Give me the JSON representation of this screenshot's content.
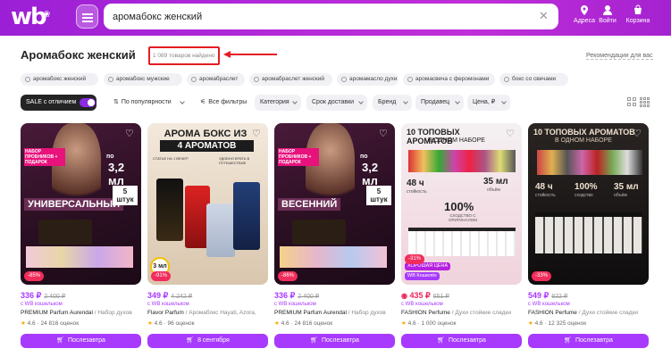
{
  "header": {
    "logo": "wb",
    "search_value": "аромабокс женский",
    "buttons": [
      {
        "label": "Адреса",
        "icon": "location-pin-icon"
      },
      {
        "label": "Войти",
        "icon": "user-icon"
      },
      {
        "label": "Корзина",
        "icon": "cart-icon"
      }
    ]
  },
  "page": {
    "title": "Аромабокс женский",
    "count": "1 089 товаров найдено",
    "recommendations": "Рекомендации для вас"
  },
  "chips": [
    "аромабокс женский",
    "аромабокс мужские",
    "аромабраслет",
    "аромабраслет женский",
    "аромамасло духи",
    "аромасвеча с феромонами",
    "бокс со свечами"
  ],
  "filters": {
    "sale_label": "SALE с отличием",
    "sort": "По популярности",
    "items": [
      "Все фильтры",
      "Категория",
      "Срок доставки",
      "Бренд",
      "Продавец",
      "Цена, ₽"
    ]
  },
  "products": [
    {
      "price": "336 ₽",
      "old_price": "2 400 ₽",
      "wallet": "с WB кошельком",
      "brand": "PREMIUM Parfum Aurendal",
      "desc": "Набор духов",
      "rating": "4.6",
      "reviews": "24 816 оценок",
      "button": "Послезавтра",
      "discount": "-85%",
      "overlay": [
        "НАБОР ПРОБНИКОВ + ПОДАРОК",
        "УНИВЕРСАЛЬНЫЙ",
        "3,2 мл",
        "5 штук",
        "по"
      ]
    },
    {
      "price": "349 ₽",
      "old_price": "4 242 ₽",
      "wallet": "с WB кошельком",
      "brand": "Flavor Parfum",
      "desc": "Аромабокс Hayati, Azora,",
      "rating": "4.6",
      "reviews": "96 оценок",
      "button": "8 сентября",
      "discount": "-91%",
      "overlay": [
        "АРОМА БОКС ИЗ",
        "4 АРОМАТОВ",
        "3 мл",
        "СТАТЬЕ НА 1 ВЕЧЕР",
        "УДОБНО БРАТЬ В ПУТЕШЕСТВИЕ"
      ]
    },
    {
      "price": "336 ₽",
      "old_price": "2 400 ₽",
      "wallet": "с WB кошельком",
      "brand": "PREMIUM Parfum Aurendal",
      "desc": "Набор духов",
      "rating": "4.6",
      "reviews": "24 816 оценок",
      "button": "Послезавтра",
      "discount": "-86%",
      "overlay": [
        "НАБОР ПРОБНИКОВ + ПОДАРОК",
        "ВЕСЕННИЙ",
        "3,2 мл",
        "5 штук",
        "по"
      ]
    },
    {
      "price": "435 ₽",
      "old_price": "651 ₽",
      "wallet": "с WB кошельком",
      "brand": "FASHION Perfume",
      "desc": "Духи стойкие сладки",
      "rating": "4.6",
      "reviews": "1 000 оценок",
      "button": "Послезавтра",
      "discount": "-31%",
      "good": "ХОРОШАЯ ЦЕНА",
      "wbw": "WB Кошелёк",
      "overlay": [
        "10 ТОПОВЫХ АРОМАТОВ",
        "В ОДНОМ НАБОРЕ",
        "48 ч",
        "35 мл",
        "100%",
        "СХОДСТВО С ОРИГИНАЛОМ",
        "стойкость",
        "объём"
      ]
    },
    {
      "price": "549 ₽",
      "old_price": "822 ₽",
      "wallet": "с WB кошельком",
      "brand": "FASHION Perfume",
      "desc": "Духи стойкие сладки",
      "rating": "4.6",
      "reviews": "12 325 оценок",
      "button": "Послезавтра",
      "discount": "-33%",
      "overlay": [
        "10 ТОПОВЫХ АРОМАТОВ",
        "В ОДНОМ НАБОРЕ",
        "48 ч",
        "100%",
        "35 мл",
        "стойкость",
        "сходство",
        "объём"
      ]
    }
  ],
  "colors": {
    "brand": "#a73afd",
    "header": "#b52ad8",
    "discount": "#f12d5b",
    "highlight": "#e51c23"
  }
}
